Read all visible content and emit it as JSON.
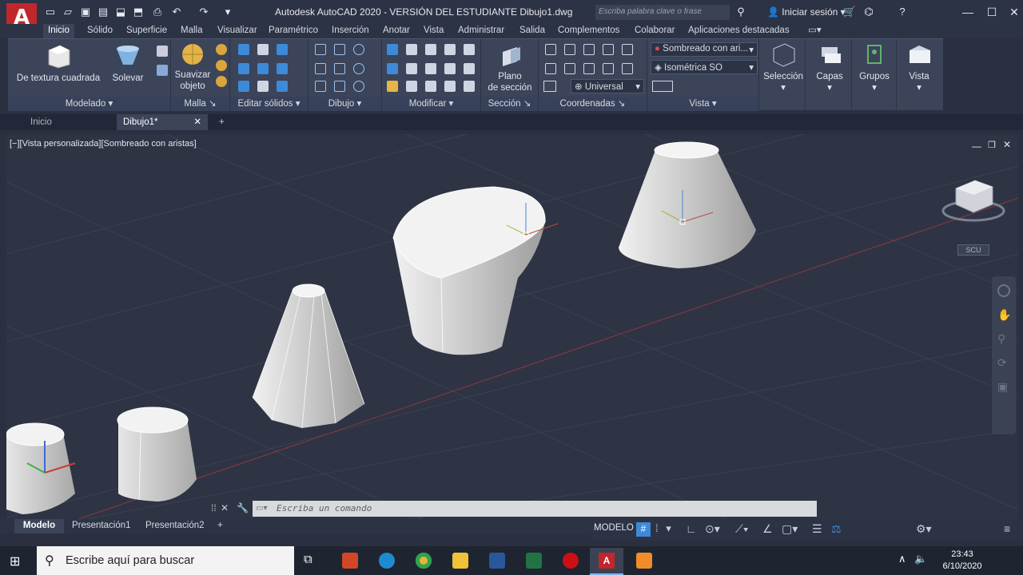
{
  "app": {
    "logo": "A",
    "title": "Autodesk AutoCAD 2020 - VERSIÓN DEL ESTUDIANTE   Dibujo1.dwg",
    "search_placeholder": "Escriba palabra clave o frase",
    "signin": "Iniciar sesión"
  },
  "ribbon_tabs": [
    "Inicio",
    "Sólido",
    "Superficie",
    "Malla",
    "Visualizar",
    "Paramétrico",
    "Inserción",
    "Anotar",
    "Vista",
    "Administrar",
    "Salida",
    "Complementos",
    "Colaborar",
    "Aplicaciones destacadas"
  ],
  "panels": {
    "modelado": {
      "title": "Modelado",
      "btn1": "De textura cuadrada",
      "btn2": "Solevar"
    },
    "malla": {
      "title": "Malla",
      "btn1_l1": "Suavizar",
      "btn1_l2": "objeto"
    },
    "editar": {
      "title": "Editar sólidos"
    },
    "dibujo": {
      "title": "Dibujo"
    },
    "modificar": {
      "title": "Modificar"
    },
    "seccion": {
      "title": "Sección",
      "btn_l1": "Plano",
      "btn_l2": "de sección"
    },
    "coordenadas": {
      "title": "Coordenadas",
      "ucs": "Universal"
    },
    "vista": {
      "title": "Vista",
      "style": "Sombreado con ari...",
      "view": "Isométrica SO"
    },
    "seleccion": "Selección",
    "capas": "Capas",
    "grupos": "Grupos",
    "vistabtn": "Vista"
  },
  "file_tabs": [
    "Inicio",
    "Dibujo1*"
  ],
  "viewport": {
    "label": "[−][Vista personalizada][Sombreado con aristas]",
    "ucs_label": "SCU"
  },
  "command": {
    "placeholder": "Escriba un comando"
  },
  "layout_tabs": [
    "Modelo",
    "Presentación1",
    "Presentación2"
  ],
  "status": {
    "mode": "MODELO"
  },
  "taskbar": {
    "search": "Escribe aquí para buscar",
    "time": "23:43",
    "date": "6/10/2020"
  },
  "colors": {
    "accent": "#c1262b",
    "ribbon": "#3b4459",
    "viewport": "#2e3444"
  }
}
